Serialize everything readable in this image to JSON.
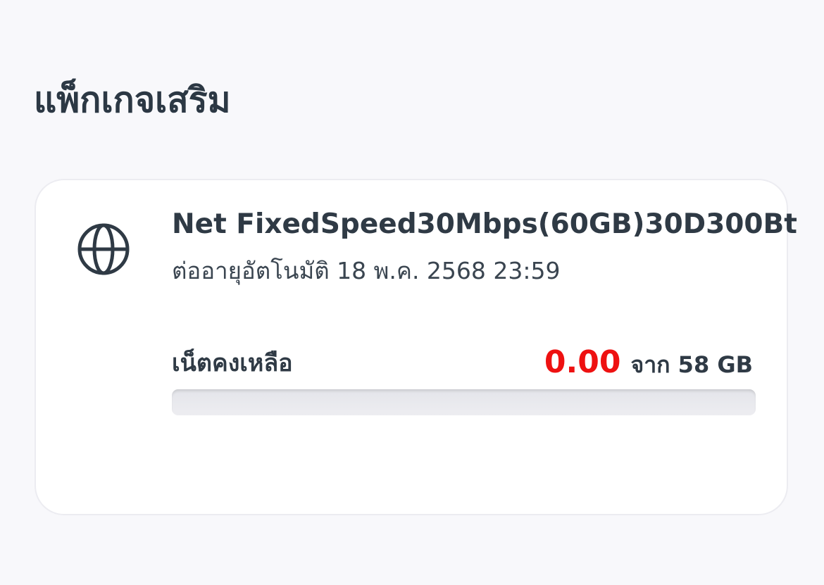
{
  "section": {
    "title": "แพ็กเกจเสริม"
  },
  "package": {
    "icon": "globe-icon",
    "name": "Net FixedSpeed30Mbps(60GB)30D300Bt",
    "renewal": "ต่ออายุอัตโนมัติ 18 พ.ค. 2568 23:59",
    "remaining_label": "เน็ตคงเหลือ",
    "remaining_amount": "0.00",
    "total_text": "จาก 58 GB",
    "remaining_fraction": 0,
    "colors": {
      "amount": "#ee1111",
      "track": "#ebebef",
      "text": "#2f3a45"
    }
  }
}
